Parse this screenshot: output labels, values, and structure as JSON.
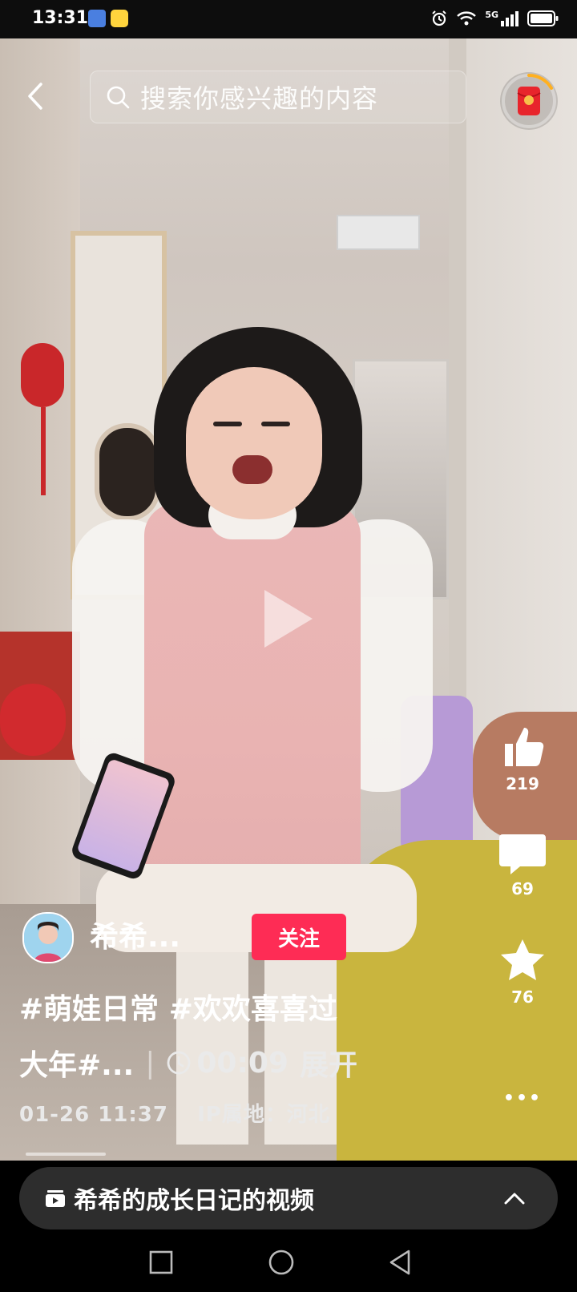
{
  "status_bar": {
    "time": "13:31",
    "network": "5G",
    "icons": [
      "alarm-icon",
      "wifi-icon",
      "signal-icon",
      "battery-icon"
    ]
  },
  "search": {
    "placeholder": "搜索你感兴趣的内容"
  },
  "actions": {
    "like_count": "219",
    "comment_count": "69",
    "favorite_count": "76",
    "more_label": "•••"
  },
  "author": {
    "username": "希希...",
    "follow_label": "关注"
  },
  "caption": {
    "line1": "#萌娃日常 #欢欢喜喜过",
    "line2": "大年#...",
    "duration": "00:09",
    "expand_label": "展开",
    "date": "01-26 11:37",
    "ip_location": "IP属地：河北"
  },
  "collection": {
    "title": "希希的成长日记的视频"
  },
  "colors": {
    "follow": "#fe2c55",
    "collection_bg": "#2d2d2d"
  }
}
